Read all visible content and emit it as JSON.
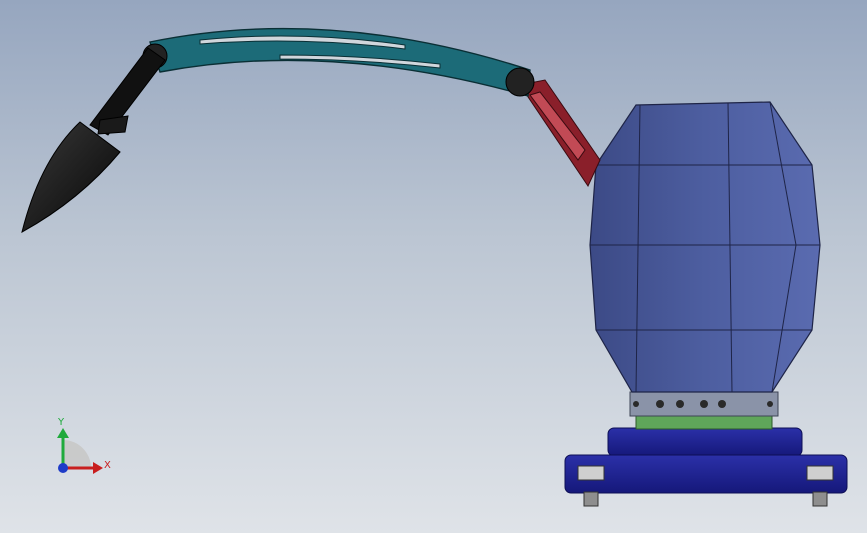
{
  "viewport": {
    "background_top": "#96a6bf",
    "background_bottom": "#dfe3e8"
  },
  "model": {
    "parts": [
      "end-effector",
      "wrist-link",
      "upper-arm",
      "forearm-link",
      "body-housing",
      "bearing-ring",
      "mount-plate"
    ],
    "colors": {
      "upper_arm": "#1c6b78",
      "forearm_link": "#8a1f2a",
      "body": "#4a5a9a",
      "bearing_ring": "#5fa65a",
      "base": "#1b1f8c",
      "end_effector": "#111111"
    }
  },
  "triad": {
    "y_label": "Y",
    "x_label": "X",
    "x_color": "#c81e1e",
    "y_color": "#1faa3c",
    "z_color": "#1e3cc8"
  }
}
